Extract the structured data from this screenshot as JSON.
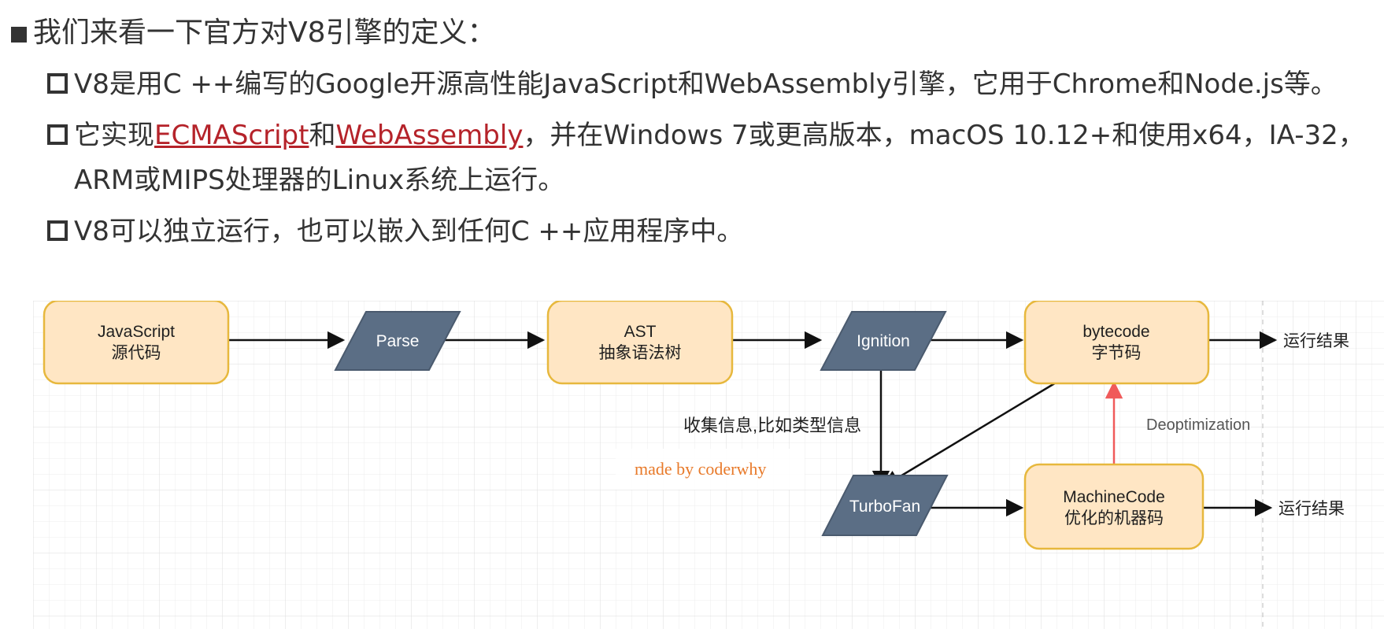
{
  "heading": "我们来看一下官方对V8引擎的定义：",
  "points": [
    {
      "text": "V8是用C ++编写的Google开源高性能JavaScript和WebAssembly引擎，它用于Chrome和Node.js等。"
    },
    {
      "prefix": "它实现",
      "link1": "ECMAScript",
      "mid": "和",
      "link2": "WebAssembly",
      "suffix": "，并在Windows 7或更高版本，macOS 10.12+和使用x64，IA-32，",
      "continuation": "ARM或MIPS处理器的Linux系统上运行。"
    },
    {
      "text": "V8可以独立运行，也可以嵌入到任何C ++应用程序中。"
    }
  ],
  "diagram": {
    "nodes": {
      "js": [
        "JavaScript",
        "源代码"
      ],
      "parse": "Parse",
      "ast": [
        "AST",
        "抽象语法树"
      ],
      "ignition": "Ignition",
      "bytecode": [
        "bytecode",
        "字节码"
      ],
      "turbofan": "TurboFan",
      "machine": [
        "MachineCode",
        "优化的机器码"
      ]
    },
    "labels": {
      "result1": "运行结果",
      "result2": "运行结果",
      "collect": "收集信息,比如类型信息",
      "deopt": "Deoptimization",
      "watermark": "made by coderwhy"
    },
    "colors": {
      "node_fill": "#ffe6c4",
      "node_stroke": "#e7b83d",
      "para_fill": "#5b6e85",
      "para_text": "#ffffff",
      "arrow": "#111111",
      "deopt_arrow": "#f05a5a",
      "watermark": "#e87a2a",
      "grid": "#e5e5e5"
    }
  }
}
